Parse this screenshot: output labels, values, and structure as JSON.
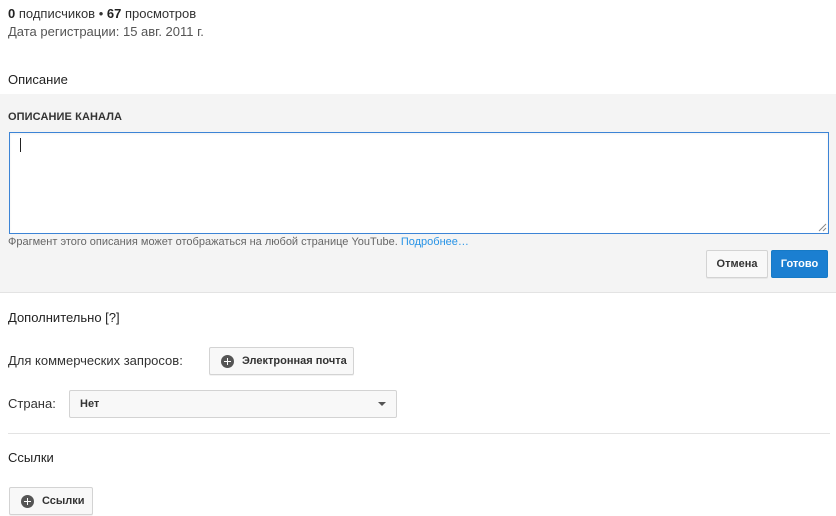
{
  "stats": {
    "subscribers_count": "0",
    "subscribers_label": " подписчиков",
    "separator": " • ",
    "views_count": "67",
    "views_label": " просмотров"
  },
  "registration": "Дата регистрации: 15 авг. 2011 г.",
  "description_section": {
    "title": "Описание",
    "field_label": "ОПИСАНИЕ КАНАЛА",
    "value": "",
    "hint_text": "Фрагмент этого описания может отображаться на любой странице YouTube. ",
    "hint_link": "Подробнее…",
    "cancel_label": "Отмена",
    "done_label": "Готово"
  },
  "additional_section": {
    "title": "Дополнительно [?]",
    "business_label": "Для коммерческих запросов:",
    "email_button": "Электронная почта",
    "country_label": "Страна:",
    "country_value": "Нет"
  },
  "links_section": {
    "title": "Ссылки",
    "links_button": "Ссылки"
  },
  "colors": {
    "accent": "#1b7fd1",
    "link": "#2793e6",
    "panel_bg": "#f4f4f4"
  }
}
